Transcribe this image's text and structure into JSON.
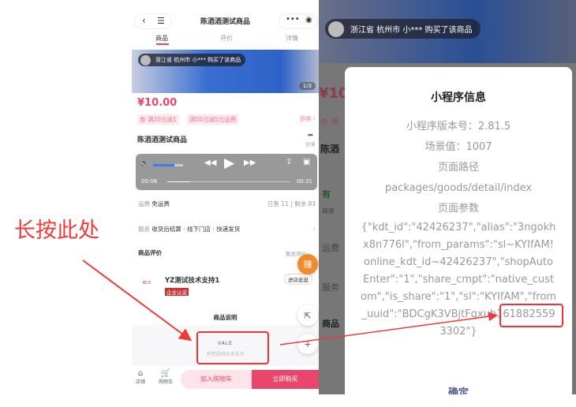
{
  "annotation": {
    "label": "长按此处",
    "color": "#f03a3a"
  },
  "left_phone": {
    "title": "陈酒酒测试商品",
    "tabs": [
      "商品",
      "评价",
      "详情"
    ],
    "toast": "浙江省 杭州市 小*** 购买了该商品",
    "image_counter": "1/3",
    "price": "¥10.00",
    "coupons": [
      "券 满20元减1",
      "满50元减5元运费"
    ],
    "get_coupon": "领券 ›",
    "product_name": "陈酒酒测试商品",
    "share": "分享",
    "player": {
      "current": "00:06",
      "total": "00:31",
      "progress": 0.19,
      "volume": 0.7
    },
    "shipping_label": "运费",
    "shipping_value": "免运费",
    "sold": "已售 11 | 剩余 83",
    "service_label": "服务",
    "service_value": "收货后结算 · 线下门店 · 快递发货",
    "reviews_label": "商品评价",
    "reviews_more": "暂无评价",
    "shop_name": "YZ测试技术支持1",
    "shop_badge": "企业认证",
    "visit_shop": "进店逛逛",
    "desc_label": "商品说明",
    "vale_logo": "VALE",
    "support": "有赞提供技术支持",
    "earn": "赚",
    "bottom": {
      "store": "店铺",
      "cart": "购物车",
      "add_cart": "加入购物车",
      "buy_now": "立即购买"
    },
    "accent": "#e8466b"
  },
  "right_phone": {
    "toast": "浙江省 杭州市 小*** 购买了该商品",
    "bg_fragments": [
      "¥10",
      "券 满",
      "陈酒",
      "有",
      "商家",
      "运费",
      "服务",
      "商品"
    ],
    "dialog": {
      "title": "小程序信息",
      "version": "小程序版本号：2.81.5",
      "scene": "场景值：1007",
      "path_label": "页面路径",
      "path": "packages/goods/detail/index",
      "params_label": "页面参数",
      "params": "{\"kdt_id\":\"42426237\",\"alias\":\"3ngokhx8n776l\",\"from_params\":\"sl~KYIfAM!online_kdt_id~42426237\",\"shopAutoEnter\":\"1\",\"share_cmpt\":\"native_custom\",\"is_share\":\"1\",\"sl\":\"KYIfAM\",\"from_uuid\":\"BDCgK3VBjtFqxub1618825593302\"}",
      "confirm": "确定"
    }
  }
}
